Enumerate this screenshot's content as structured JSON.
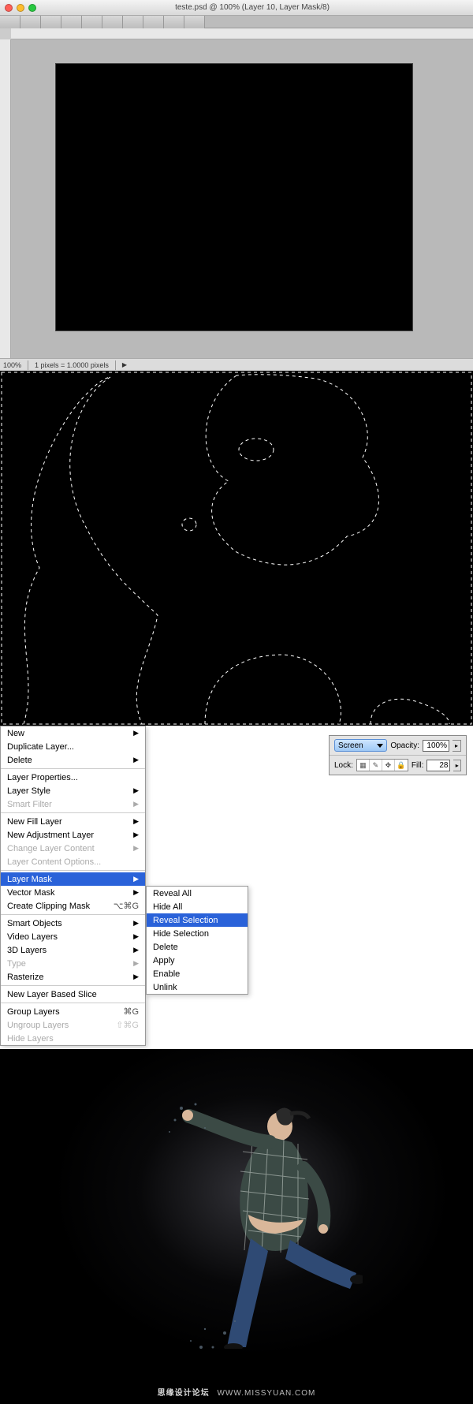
{
  "window": {
    "title": "teste.psd @ 100% (Layer 10, Layer Mask/8)",
    "zoom": "100%",
    "scale": "1 pixels = 1.0000 pixels"
  },
  "context_menu": {
    "items": [
      {
        "label": "New",
        "arrow": true
      },
      {
        "label": "Duplicate Layer..."
      },
      {
        "label": "Delete",
        "arrow": true
      },
      {
        "sep": true
      },
      {
        "label": "Layer Properties..."
      },
      {
        "label": "Layer Style",
        "arrow": true
      },
      {
        "label": "Smart Filter",
        "disabled": true,
        "arrow": true
      },
      {
        "sep": true
      },
      {
        "label": "New Fill Layer",
        "arrow": true
      },
      {
        "label": "New Adjustment Layer",
        "arrow": true
      },
      {
        "label": "Change Layer Content",
        "disabled": true,
        "arrow": true
      },
      {
        "label": "Layer Content Options...",
        "disabled": true
      },
      {
        "sep": true
      },
      {
        "label": "Layer Mask",
        "arrow": true,
        "hl": true
      },
      {
        "label": "Vector Mask",
        "arrow": true
      },
      {
        "label": "Create Clipping Mask",
        "shortcut": "⌥⌘G"
      },
      {
        "sep": true
      },
      {
        "label": "Smart Objects",
        "arrow": true
      },
      {
        "label": "Video Layers",
        "arrow": true
      },
      {
        "label": "3D Layers",
        "arrow": true
      },
      {
        "label": "Type",
        "disabled": true,
        "arrow": true
      },
      {
        "label": "Rasterize",
        "arrow": true
      },
      {
        "sep": true
      },
      {
        "label": "New Layer Based Slice"
      },
      {
        "sep": true
      },
      {
        "label": "Group Layers",
        "shortcut": "⌘G"
      },
      {
        "label": "Ungroup Layers",
        "disabled": true,
        "shortcut": "⇧⌘G"
      },
      {
        "label": "Hide Layers",
        "disabled": true
      }
    ]
  },
  "submenu": {
    "items": [
      {
        "label": "Reveal All"
      },
      {
        "label": "Hide All"
      },
      {
        "label": "Reveal Selection",
        "hl": true
      },
      {
        "label": "Hide Selection"
      },
      {
        "sep": true
      },
      {
        "label": "Delete",
        "disabled": true
      },
      {
        "label": "Apply",
        "disabled": true
      },
      {
        "sep": true
      },
      {
        "label": "Enable",
        "disabled": true
      },
      {
        "label": "Unlink",
        "disabled": true
      }
    ]
  },
  "layers_panel": {
    "blend_mode": "Screen",
    "opacity_label": "Opacity:",
    "opacity_value": "100%",
    "lock_label": "Lock:",
    "fill_label": "Fill:",
    "fill_value": "28"
  },
  "watermark": {
    "zh": "思缘设计论坛",
    "url": "WWW.MISSYUAN.COM"
  }
}
